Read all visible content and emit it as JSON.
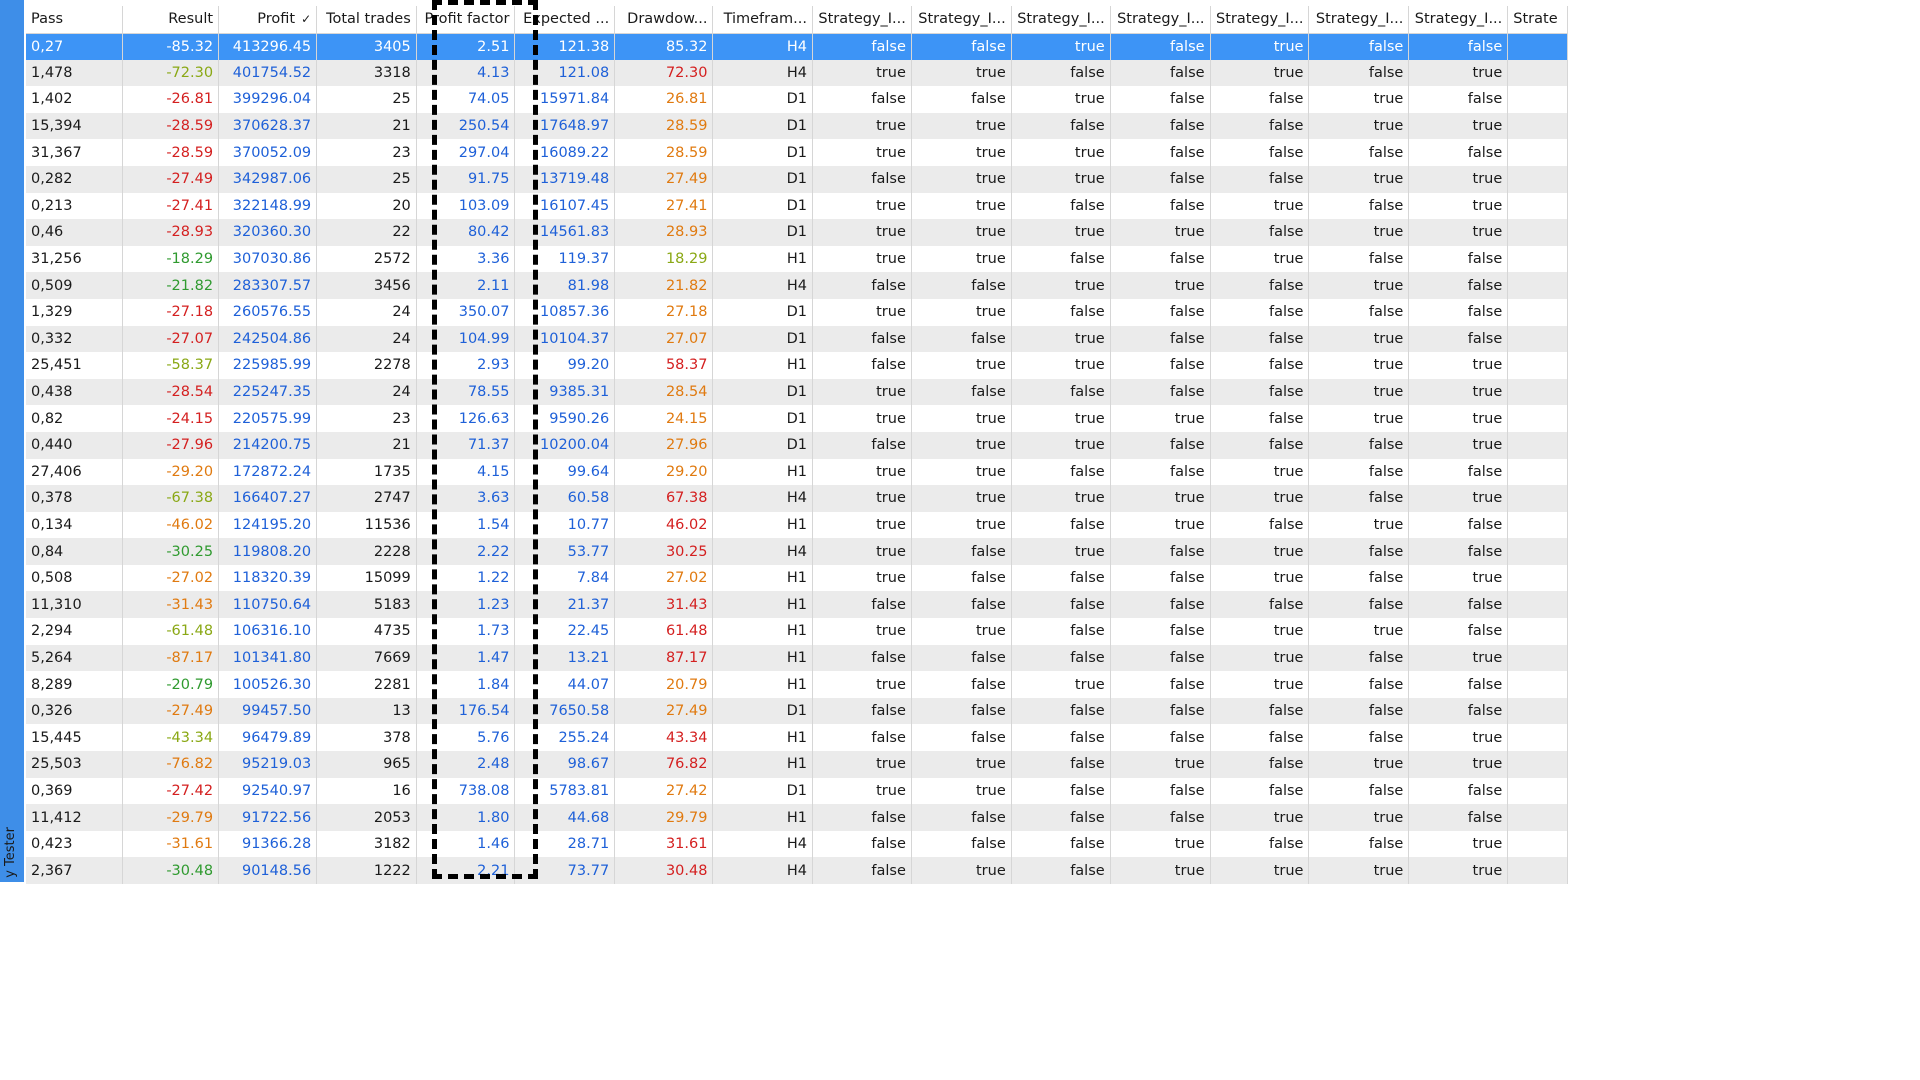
{
  "side_label": "y Tester",
  "columns": [
    "Pass",
    "Result",
    "Profit",
    "Total trades",
    "Profit factor",
    "Expected ...",
    "Drawdow...",
    "Timefram...",
    "Strategy_I...",
    "Strategy_I...",
    "Strategy_I...",
    "Strategy_I...",
    "Strategy_I...",
    "Strategy_I...",
    "Strategy_I...",
    "Strate"
  ],
  "sort_indicator": "✓",
  "rows": [
    [
      "0,27",
      "-85.32",
      "413296.45",
      "3405",
      "2.51",
      "121.38",
      "85.32",
      "H4",
      "false",
      "false",
      "true",
      "false",
      "true",
      "false",
      "false"
    ],
    [
      "1,478",
      "-72.30",
      "401754.52",
      "3318",
      "4.13",
      "121.08",
      "72.30",
      "H4",
      "true",
      "true",
      "false",
      "false",
      "true",
      "false",
      "true"
    ],
    [
      "1,402",
      "-26.81",
      "399296.04",
      "25",
      "74.05",
      "15971.84",
      "26.81",
      "D1",
      "false",
      "false",
      "true",
      "false",
      "false",
      "true",
      "false"
    ],
    [
      "15,394",
      "-28.59",
      "370628.37",
      "21",
      "250.54",
      "17648.97",
      "28.59",
      "D1",
      "true",
      "true",
      "false",
      "false",
      "false",
      "true",
      "true"
    ],
    [
      "31,367",
      "-28.59",
      "370052.09",
      "23",
      "297.04",
      "16089.22",
      "28.59",
      "D1",
      "true",
      "true",
      "true",
      "false",
      "false",
      "false",
      "false"
    ],
    [
      "0,282",
      "-27.49",
      "342987.06",
      "25",
      "91.75",
      "13719.48",
      "27.49",
      "D1",
      "false",
      "true",
      "true",
      "false",
      "false",
      "true",
      "true"
    ],
    [
      "0,213",
      "-27.41",
      "322148.99",
      "20",
      "103.09",
      "16107.45",
      "27.41",
      "D1",
      "true",
      "true",
      "false",
      "false",
      "true",
      "false",
      "true"
    ],
    [
      "0,46",
      "-28.93",
      "320360.30",
      "22",
      "80.42",
      "14561.83",
      "28.93",
      "D1",
      "true",
      "true",
      "true",
      "true",
      "false",
      "true",
      "true"
    ],
    [
      "31,256",
      "-18.29",
      "307030.86",
      "2572",
      "3.36",
      "119.37",
      "18.29",
      "H1",
      "true",
      "true",
      "false",
      "false",
      "true",
      "false",
      "false"
    ],
    [
      "0,509",
      "-21.82",
      "283307.57",
      "3456",
      "2.11",
      "81.98",
      "21.82",
      "H4",
      "false",
      "false",
      "true",
      "true",
      "false",
      "true",
      "false"
    ],
    [
      "1,329",
      "-27.18",
      "260576.55",
      "24",
      "350.07",
      "10857.36",
      "27.18",
      "D1",
      "true",
      "true",
      "false",
      "false",
      "false",
      "false",
      "false"
    ],
    [
      "0,332",
      "-27.07",
      "242504.86",
      "24",
      "104.99",
      "10104.37",
      "27.07",
      "D1",
      "false",
      "false",
      "true",
      "false",
      "false",
      "true",
      "false"
    ],
    [
      "25,451",
      "-58.37",
      "225985.99",
      "2278",
      "2.93",
      "99.20",
      "58.37",
      "H1",
      "false",
      "true",
      "true",
      "false",
      "false",
      "true",
      "true"
    ],
    [
      "0,438",
      "-28.54",
      "225247.35",
      "24",
      "78.55",
      "9385.31",
      "28.54",
      "D1",
      "true",
      "false",
      "false",
      "false",
      "false",
      "true",
      "true"
    ],
    [
      "0,82",
      "-24.15",
      "220575.99",
      "23",
      "126.63",
      "9590.26",
      "24.15",
      "D1",
      "true",
      "true",
      "true",
      "true",
      "false",
      "true",
      "true"
    ],
    [
      "0,440",
      "-27.96",
      "214200.75",
      "21",
      "71.37",
      "10200.04",
      "27.96",
      "D1",
      "false",
      "true",
      "true",
      "false",
      "false",
      "false",
      "true"
    ],
    [
      "27,406",
      "-29.20",
      "172872.24",
      "1735",
      "4.15",
      "99.64",
      "29.20",
      "H1",
      "true",
      "true",
      "false",
      "false",
      "true",
      "false",
      "false"
    ],
    [
      "0,378",
      "-67.38",
      "166407.27",
      "2747",
      "3.63",
      "60.58",
      "67.38",
      "H4",
      "true",
      "true",
      "true",
      "true",
      "true",
      "false",
      "true"
    ],
    [
      "0,134",
      "-46.02",
      "124195.20",
      "11536",
      "1.54",
      "10.77",
      "46.02",
      "H1",
      "true",
      "true",
      "false",
      "true",
      "false",
      "true",
      "false"
    ],
    [
      "0,84",
      "-30.25",
      "119808.20",
      "2228",
      "2.22",
      "53.77",
      "30.25",
      "H4",
      "true",
      "false",
      "true",
      "false",
      "true",
      "false",
      "false"
    ],
    [
      "0,508",
      "-27.02",
      "118320.39",
      "15099",
      "1.22",
      "7.84",
      "27.02",
      "H1",
      "true",
      "false",
      "false",
      "false",
      "true",
      "false",
      "true"
    ],
    [
      "11,310",
      "-31.43",
      "110750.64",
      "5183",
      "1.23",
      "21.37",
      "31.43",
      "H1",
      "false",
      "false",
      "false",
      "false",
      "false",
      "false",
      "false"
    ],
    [
      "2,294",
      "-61.48",
      "106316.10",
      "4735",
      "1.73",
      "22.45",
      "61.48",
      "H1",
      "true",
      "true",
      "false",
      "false",
      "true",
      "true",
      "false"
    ],
    [
      "5,264",
      "-87.17",
      "101341.80",
      "7669",
      "1.47",
      "13.21",
      "87.17",
      "H1",
      "false",
      "false",
      "false",
      "false",
      "true",
      "false",
      "true"
    ],
    [
      "8,289",
      "-20.79",
      "100526.30",
      "2281",
      "1.84",
      "44.07",
      "20.79",
      "H1",
      "true",
      "false",
      "true",
      "false",
      "true",
      "false",
      "false"
    ],
    [
      "0,326",
      "-27.49",
      "99457.50",
      "13",
      "176.54",
      "7650.58",
      "27.49",
      "D1",
      "false",
      "false",
      "false",
      "false",
      "false",
      "false",
      "false"
    ],
    [
      "15,445",
      "-43.34",
      "96479.89",
      "378",
      "5.76",
      "255.24",
      "43.34",
      "H1",
      "false",
      "false",
      "false",
      "false",
      "false",
      "false",
      "true"
    ],
    [
      "25,503",
      "-76.82",
      "95219.03",
      "965",
      "2.48",
      "98.67",
      "76.82",
      "H1",
      "true",
      "true",
      "false",
      "true",
      "false",
      "true",
      "true"
    ],
    [
      "0,369",
      "-27.42",
      "92540.97",
      "16",
      "738.08",
      "5783.81",
      "27.42",
      "D1",
      "true",
      "true",
      "false",
      "false",
      "false",
      "false",
      "false"
    ],
    [
      "11,412",
      "-29.79",
      "91722.56",
      "2053",
      "1.80",
      "44.68",
      "29.79",
      "H1",
      "false",
      "false",
      "false",
      "false",
      "true",
      "true",
      "false"
    ],
    [
      "0,423",
      "-31.61",
      "91366.28",
      "3182",
      "1.46",
      "28.71",
      "31.61",
      "H4",
      "false",
      "false",
      "false",
      "true",
      "false",
      "false",
      "true"
    ],
    [
      "2,367",
      "-30.48",
      "90148.56",
      "1222",
      "2.21",
      "73.77",
      "30.48",
      "H4",
      "false",
      "true",
      "false",
      "true",
      "true",
      "true",
      "true"
    ]
  ],
  "result_colors": [
    "dark",
    "lime",
    "red",
    "red",
    "red",
    "red",
    "red",
    "red",
    "green",
    "green",
    "red",
    "red",
    "lime",
    "red",
    "red",
    "red",
    "orange",
    "lime",
    "orange",
    "green",
    "orange",
    "orange",
    "lime",
    "orange",
    "green",
    "orange",
    "lime",
    "orange",
    "red",
    "orange",
    "orange",
    "green"
  ],
  "drawdown_colors": [
    "dark",
    "red",
    "orange",
    "orange",
    "orange",
    "orange",
    "orange",
    "orange",
    "lime",
    "orange",
    "orange",
    "orange",
    "red",
    "orange",
    "orange",
    "orange",
    "orange",
    "red",
    "red",
    "red",
    "orange",
    "red",
    "red",
    "red",
    "orange",
    "orange",
    "red",
    "red",
    "orange",
    "orange",
    "red",
    "red"
  ],
  "colors": {
    "selection": "#3d94f6",
    "blue": "#1e60d8",
    "green": "#2f9a2f",
    "lime": "#8aa815",
    "orange": "#e07a10",
    "red": "#d42020",
    "alt_row": "#ebebeb"
  }
}
